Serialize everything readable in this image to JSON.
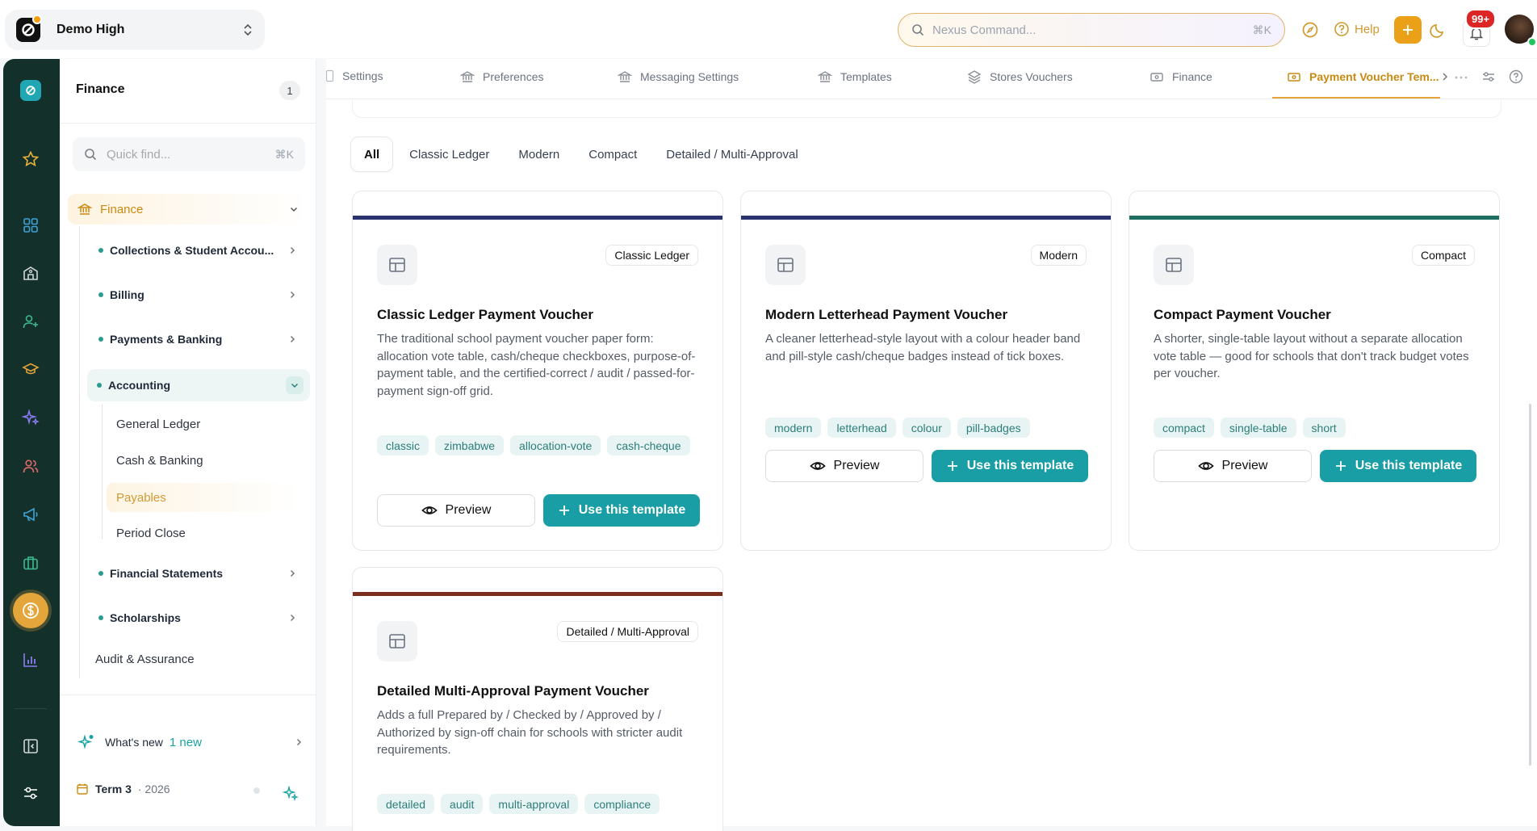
{
  "workspace": {
    "name": "Demo High"
  },
  "topbar": {
    "search_placeholder": "Nexus Command...",
    "search_shortcut": "⌘K",
    "help_label": "Help",
    "notifications_badge": "99+"
  },
  "nav": {
    "title": "Finance",
    "count": "1",
    "search_placeholder": "Quick find...",
    "search_shortcut": "⌘K",
    "root_label": "Finance",
    "sections": [
      {
        "label": "Collections & Student Accou..."
      },
      {
        "label": "Billing"
      },
      {
        "label": "Payments & Banking"
      },
      {
        "label": "Accounting"
      },
      {
        "label": "Financial Statements"
      },
      {
        "label": "Scholarships"
      }
    ],
    "accounting_children": [
      "General Ledger",
      "Cash & Banking",
      "Payables",
      "Period Close"
    ],
    "audit_label": "Audit & Assurance",
    "whats_new_label": "What's new",
    "whats_new_count": "1 new",
    "term_label": "Term 3",
    "term_year": "· 2026"
  },
  "tabs": [
    {
      "label": "Settings"
    },
    {
      "label": "Preferences"
    },
    {
      "label": "Messaging Settings"
    },
    {
      "label": "Templates"
    },
    {
      "label": "Stores Vouchers"
    },
    {
      "label": "Finance"
    },
    {
      "label": "Payment Voucher Tem..."
    }
  ],
  "filters": [
    "All",
    "Classic Ledger",
    "Modern",
    "Compact",
    "Detailed / Multi-Approval"
  ],
  "cards": [
    {
      "badge": "Classic Ledger",
      "title": "Classic Ledger Payment Voucher",
      "description": "The traditional school payment voucher paper form: allocation vote table, cash/cheque checkboxes, purpose-of-payment table, and the certified-correct / audit / passed-for-payment sign-off grid.",
      "tags": [
        "classic",
        "zimbabwe",
        "allocation-vote",
        "cash-cheque"
      ],
      "stripe_color": "#2a3370"
    },
    {
      "badge": "Modern",
      "title": "Modern Letterhead Payment Voucher",
      "description": "A cleaner letterhead-style layout with a colour header band and pill-style cash/cheque badges instead of tick boxes.",
      "tags": [
        "modern",
        "letterhead",
        "colour",
        "pill-badges"
      ],
      "stripe_color": "#2a3370"
    },
    {
      "badge": "Compact",
      "title": "Compact Payment Voucher",
      "description": "A shorter, single-table layout without a separate allocation vote table — good for schools that don't track budget votes per voucher.",
      "tags": [
        "compact",
        "single-table",
        "short"
      ],
      "stripe_color": "#1f6e62"
    },
    {
      "badge": "Detailed / Multi-Approval",
      "title": "Detailed Multi-Approval Payment Voucher",
      "description": "Adds a full Prepared by / Checked by / Approved by / Authorized by sign-off chain for schools with stricter audit requirements.",
      "tags": [
        "detailed",
        "audit",
        "multi-approval",
        "compliance"
      ],
      "stripe_color": "#7a2e1c"
    }
  ],
  "buttons": {
    "preview": "Preview",
    "use": "Use this template"
  },
  "colors": {
    "accent": "#1a9ea6",
    "brand": "#e4a63a",
    "rail": "#14302b"
  }
}
